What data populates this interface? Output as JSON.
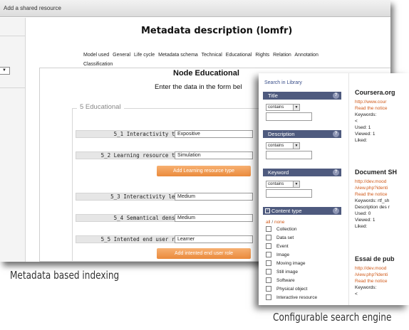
{
  "back_window": {
    "titlebar": "Add a shared resource",
    "left_stub": "▼",
    "page_title": "Metadata description (lomfr)",
    "tabs": [
      "Model used",
      "General",
      "Life cycle",
      "Metadata schema",
      "Technical",
      "Educational",
      "Rights",
      "Relation",
      "Annotation",
      "Classification"
    ],
    "node_title": "Node Educational",
    "node_subtitle": "Enter the data in the form bel",
    "section_legend": "5 Educational",
    "fields": {
      "interactivity_type": {
        "label": "5_1 Interactivity type",
        "value": "Expositive"
      },
      "learning_resource_type": {
        "label": "5_2 Learning resource type",
        "value": "Simulation"
      },
      "add_learning_resource_button": "Add Learning resource type",
      "interactivity_level": {
        "label": "5_3 Interactivity level",
        "value": "Medium"
      },
      "semantical_density": {
        "label": "5_4 Semantical density",
        "value": "Medium"
      },
      "intended_end_user_role": {
        "label": "5_5 Intented end user role",
        "value": "Learner"
      },
      "add_intended_user_button": "Add intented end user role"
    }
  },
  "front_window": {
    "search_label": "Search in Library",
    "sections": {
      "title": {
        "label": "Title",
        "operator": "contains"
      },
      "description": {
        "label": "Description",
        "operator": "contains"
      },
      "keyword": {
        "label": "Keyword",
        "operator": "contains"
      }
    },
    "help_glyph": "?",
    "content_type": {
      "label": "Content type",
      "toggle": "−",
      "all": "all",
      "separator": "/",
      "none": "none",
      "items": [
        "Collection",
        "Data set",
        "Event",
        "Image",
        "Moving image",
        "Still image",
        "Software",
        "Physical object",
        "Interactive resource"
      ]
    },
    "results": [
      {
        "title": "Coursera.org",
        "link": "http://www.cour",
        "notice": "Read the notice",
        "lines": [
          "Keywords:",
          "<",
          "Used: 1",
          "Viewed: 1",
          "Liked:"
        ]
      },
      {
        "title": "Document SH",
        "link": "http://dev.mood",
        "link2": "/view.php?identi",
        "notice": "Read the notice",
        "lines": [
          "Keywords: rtf_sh",
          "Description des r",
          "Used: 0",
          "Viewed: 1",
          "Liked:"
        ]
      },
      {
        "title": "Essai de pub",
        "link": "http://dev.mood",
        "link2": "/view.php?identi",
        "notice": "Read the notice",
        "lines": [
          "Keywords:",
          "<"
        ]
      }
    ]
  },
  "captions": {
    "left": "Metadata based indexing",
    "right": "Configurable search engine"
  }
}
